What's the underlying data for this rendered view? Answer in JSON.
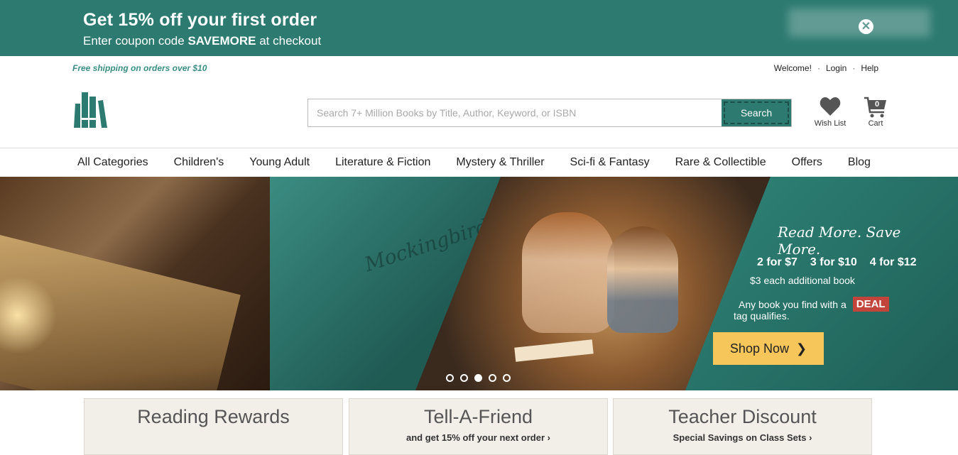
{
  "promo": {
    "title": "Get 15% off your first order",
    "sub_prefix": "Enter coupon code ",
    "code": "SAVEMORE",
    "sub_suffix": " at checkout",
    "close_icon": "close-icon"
  },
  "utility": {
    "free_shipping": "Free shipping on orders over $10",
    "welcome": "Welcome!",
    "login": "Login",
    "help": "Help",
    "separator": "·"
  },
  "header": {
    "search_placeholder": "Search 7+ Million Books by Title, Author, Keyword, or ISBN",
    "search_button": "Search",
    "wish_list": "Wish List",
    "cart": "Cart",
    "cart_count": "0",
    "accent": "#2c7a70"
  },
  "nav": {
    "items": [
      "All Categories",
      "Children's",
      "Young Adult",
      "Literature & Fiction",
      "Mystery & Thriller",
      "Sci-fi & Fantasy",
      "Rare & Collectible",
      "Offers",
      "Blog"
    ]
  },
  "hero": {
    "tagline": "Read More. Save More.",
    "deals": [
      "2 for $7",
      "3 for $10",
      "4 for $12"
    ],
    "additional": "$3 each additional book",
    "any_book": "Any book you find with a",
    "deal_tag": "DEAL",
    "qualifies": "tag qualifies.",
    "shop_button": "Shop Now",
    "shop_color": "#f7c65b",
    "slides": 5,
    "active_slide": 3
  },
  "cards": [
    {
      "title": "Reading Rewards",
      "sub": ""
    },
    {
      "title": "Tell-A-Friend",
      "sub": "and get 15% off your next order ›"
    },
    {
      "title": "Teacher Discount",
      "sub": "Special Savings on Class Sets ›"
    }
  ]
}
